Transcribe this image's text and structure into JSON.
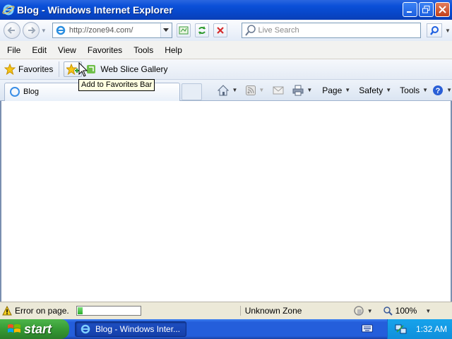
{
  "window": {
    "title": "Blog - Windows Internet Explorer"
  },
  "address": {
    "url": "http://zone94.com/"
  },
  "search": {
    "placeholder": "Live Search"
  },
  "menu": [
    "File",
    "Edit",
    "View",
    "Favorites",
    "Tools",
    "Help"
  ],
  "favorites_bar": {
    "favorites_label": "Favorites",
    "web_slice_label": "Web Slice Gallery",
    "tooltip": "Add to Favorites Bar"
  },
  "tab": {
    "label": "Blog"
  },
  "command_bar": {
    "page": "Page",
    "safety": "Safety",
    "tools": "Tools"
  },
  "status": {
    "error_text": "Error on page.",
    "zone": "Unknown Zone",
    "zoom": "100%",
    "progress_fraction": 0.08
  },
  "taskbar": {
    "start_label": "start",
    "task_label": "Blog - Windows Inter...",
    "clock": "1:32 AM"
  },
  "colors": {
    "title_bar": "#0a50d8",
    "taskbar": "#245edb",
    "start_button": "#369a34",
    "tray": "#0f8fdb"
  },
  "icons": [
    "ie-icon",
    "minimize-icon",
    "maximize-icon",
    "close-icon",
    "back-icon",
    "forward-icon",
    "compat-view-icon",
    "refresh-icon",
    "stop-icon",
    "search-icon",
    "star-icon",
    "add-favorites-icon",
    "web-slice-icon",
    "home-icon",
    "feeds-icon",
    "mail-icon",
    "print-icon",
    "help-icon",
    "warning-icon",
    "protected-mode-icon",
    "zoom-icon",
    "windows-flag-icon",
    "keyboard-icon",
    "network-icon"
  ]
}
